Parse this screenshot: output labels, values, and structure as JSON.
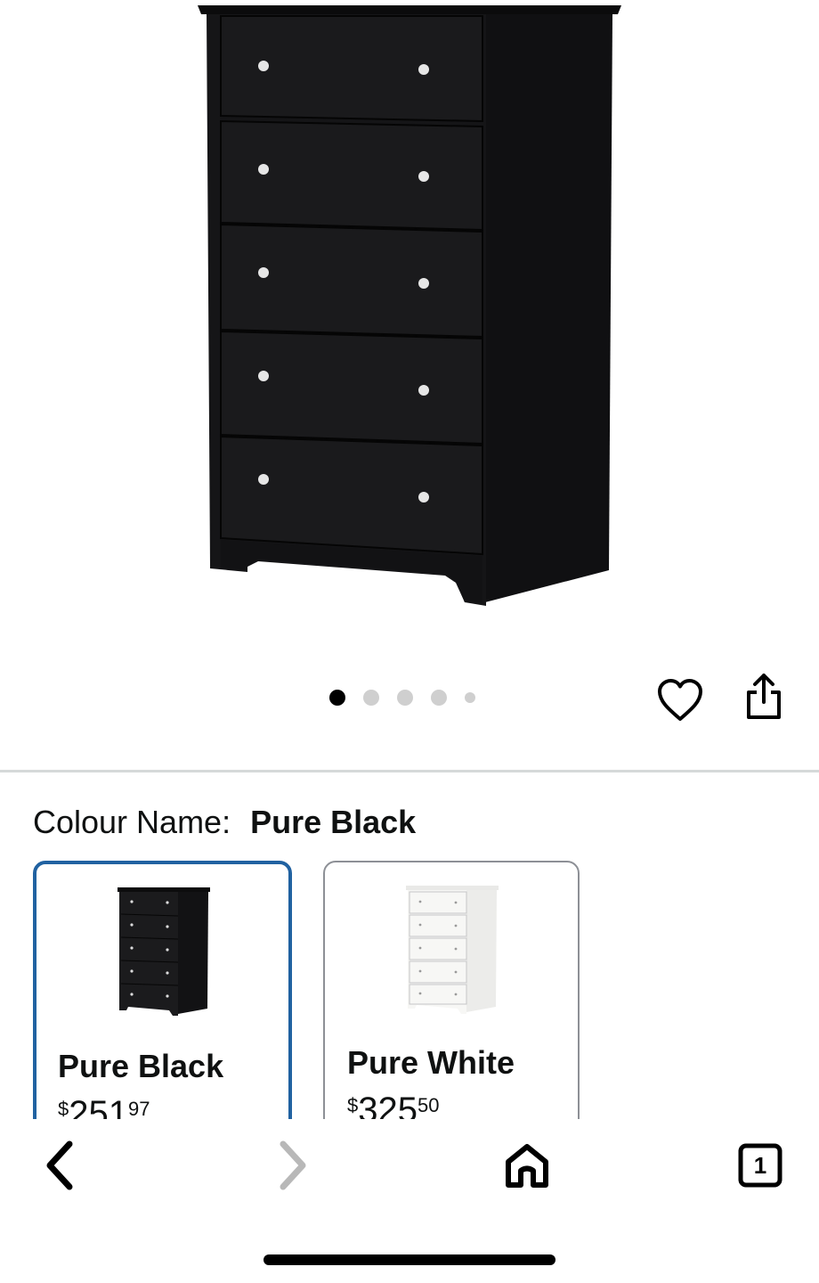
{
  "product": {
    "image_alt": "Black five-drawer dresser chest",
    "carousel": {
      "total": 5,
      "active_index": 0
    }
  },
  "actions": {
    "wishlist_icon": "heart-icon",
    "share_icon": "share-icon"
  },
  "colour": {
    "label": "Colour Name:",
    "selected": "Pure Black",
    "options": [
      {
        "name": "Pure Black",
        "price_symbol": "$",
        "price_whole": "251",
        "price_fraction": "97",
        "finish": "#1b1b1d",
        "selected": true
      },
      {
        "name": "Pure White",
        "price_symbol": "$",
        "price_whole": "325",
        "price_fraction": "50",
        "finish": "#f4f4f2",
        "selected": false
      }
    ]
  },
  "bottom_nav": {
    "back_icon": "chevron-left-icon",
    "forward_icon": "chevron-right-icon",
    "home_icon": "home-icon",
    "tabs_count": "1"
  },
  "colors": {
    "accent_selected_border": "#2162a1",
    "divider": "#d5d9d9",
    "inactive_dot": "#cfcfcf"
  }
}
